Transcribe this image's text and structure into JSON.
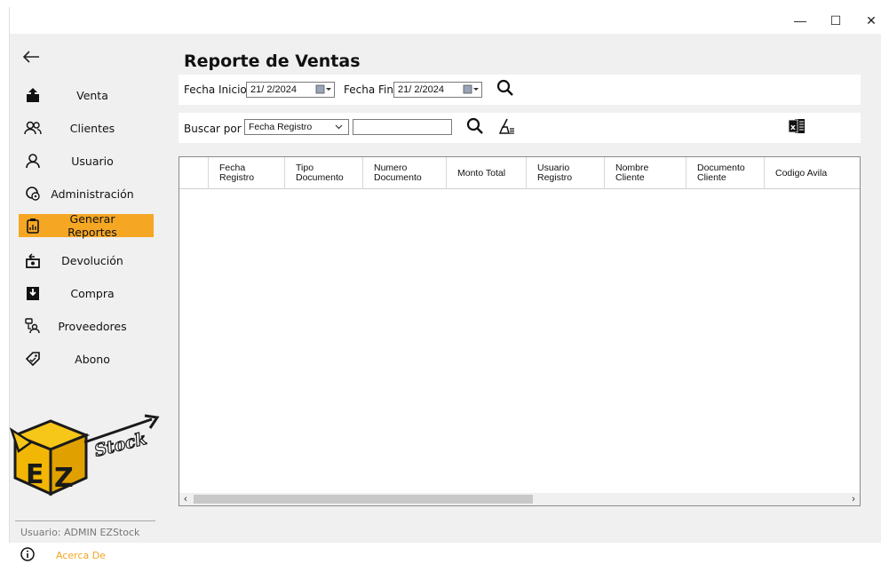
{
  "window": {
    "controls": {
      "minimize": "—",
      "maximize": "☐",
      "close": "✕"
    }
  },
  "sidebar": {
    "back_icon": "arrow-left-icon",
    "items": [
      {
        "label": "Venta",
        "icon": "upload-box-icon",
        "active": false
      },
      {
        "label": "Clientes",
        "icon": "users-icon",
        "active": false
      },
      {
        "label": "Usuario",
        "icon": "user-icon",
        "active": false
      },
      {
        "label": "Administración",
        "icon": "admin-settings-icon",
        "active": false
      },
      {
        "label": "Generar Reportes",
        "icon": "report-clipboard-icon",
        "active": true
      },
      {
        "label": "Devolución",
        "icon": "return-box-icon",
        "active": false
      },
      {
        "label": "Compra",
        "icon": "download-box-icon",
        "active": false
      },
      {
        "label": "Proveedores",
        "icon": "suppliers-icon",
        "active": false
      },
      {
        "label": "Abono",
        "icon": "tag-icon",
        "active": false
      }
    ],
    "logo_text": "EZ Stock",
    "user_label": "Usuario: ADMIN EZStock",
    "about_label": "Acerca De"
  },
  "main": {
    "title": "Reporte de Ventas",
    "filters": {
      "fecha_inicio_label": "Fecha Inicio",
      "fecha_inicio_value": "21/ 2/2024",
      "fecha_fin_label": "Fecha Fin",
      "fecha_fin_value": "21/ 2/2024"
    },
    "search": {
      "buscar_label": "Buscar por",
      "selected_option": "Fecha Registro",
      "input_value": ""
    },
    "grid": {
      "columns": [
        "Fecha\nRegistro",
        "Tipo\nDocumento",
        "Numero\nDocumento",
        "Monto Total",
        "Usuario\nRegistro",
        "Nombre\nCliente",
        "Documento\nCliente",
        "Codigo Avila"
      ],
      "rows": []
    },
    "scroll_left": "‹",
    "scroll_right": "›"
  },
  "colors": {
    "accent": "#f5a623",
    "panel": "#ffffff",
    "background": "#f0f0f0"
  }
}
